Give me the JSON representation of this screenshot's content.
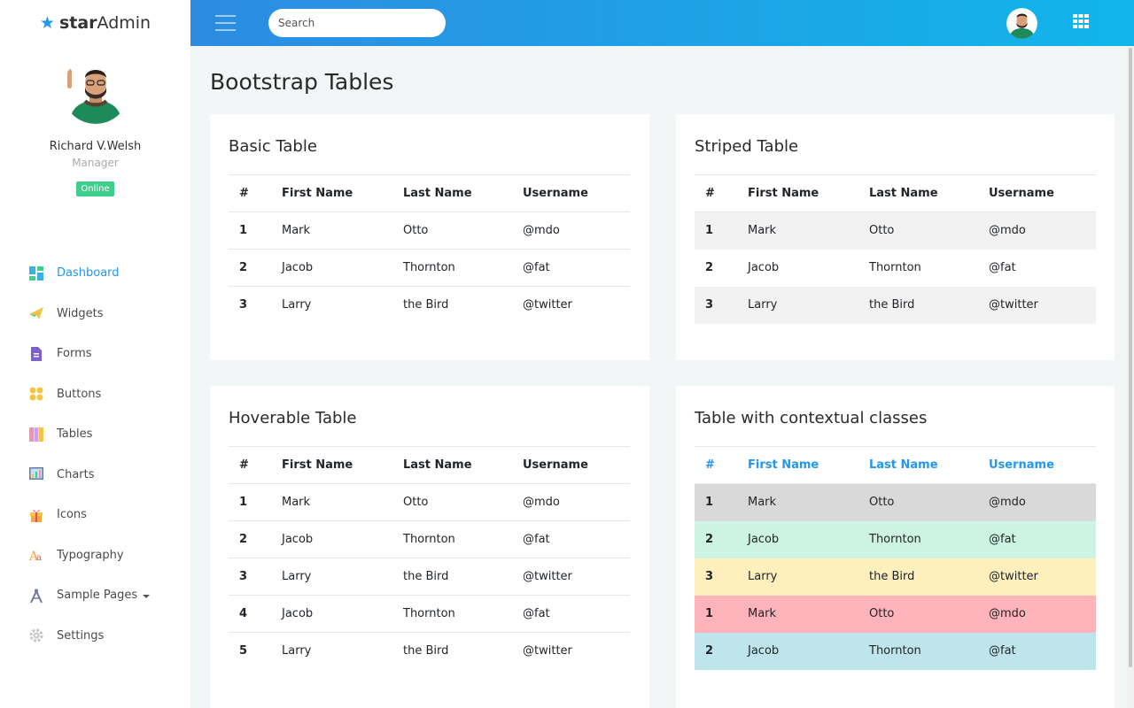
{
  "brand": {
    "prefix": "star",
    "suffix": "Admin"
  },
  "profile": {
    "name": "Richard V.Welsh",
    "role": "Manager",
    "status": "Online"
  },
  "sidebar": {
    "items": [
      {
        "label": "Dashboard",
        "icon": "dashboard-icon"
      },
      {
        "label": "Widgets",
        "icon": "paper-plane-icon"
      },
      {
        "label": "Forms",
        "icon": "document-icon"
      },
      {
        "label": "Buttons",
        "icon": "circles-icon"
      },
      {
        "label": "Tables",
        "icon": "columns-icon"
      },
      {
        "label": "Charts",
        "icon": "chart-icon"
      },
      {
        "label": "Icons",
        "icon": "gift-icon"
      },
      {
        "label": "Typography",
        "icon": "font-icon"
      },
      {
        "label": "Sample Pages",
        "icon": "compass-icon"
      },
      {
        "label": "Settings",
        "icon": "gear-icon"
      }
    ]
  },
  "topbar": {
    "search_placeholder": "Search"
  },
  "page": {
    "title": "Bootstrap Tables"
  },
  "tables": {
    "headers": [
      "#",
      "First Name",
      "Last Name",
      "Username"
    ],
    "basic": {
      "title": "Basic Table",
      "rows": [
        [
          "1",
          "Mark",
          "Otto",
          "@mdo"
        ],
        [
          "2",
          "Jacob",
          "Thornton",
          "@fat"
        ],
        [
          "3",
          "Larry",
          "the Bird",
          "@twitter"
        ]
      ]
    },
    "striped": {
      "title": "Striped Table",
      "rows": [
        [
          "1",
          "Mark",
          "Otto",
          "@mdo"
        ],
        [
          "2",
          "Jacob",
          "Thornton",
          "@fat"
        ],
        [
          "3",
          "Larry",
          "the Bird",
          "@twitter"
        ]
      ]
    },
    "hoverable": {
      "title": "Hoverable Table",
      "rows": [
        [
          "1",
          "Mark",
          "Otto",
          "@mdo"
        ],
        [
          "2",
          "Jacob",
          "Thornton",
          "@fat"
        ],
        [
          "3",
          "Larry",
          "the Bird",
          "@twitter"
        ],
        [
          "4",
          "Jacob",
          "Thornton",
          "@fat"
        ],
        [
          "5",
          "Larry",
          "the Bird",
          "@twitter"
        ]
      ]
    },
    "contextual": {
      "title": "Table with contextual classes",
      "rows": [
        [
          "1",
          "Mark",
          "Otto",
          "@mdo"
        ],
        [
          "2",
          "Jacob",
          "Thornton",
          "@fat"
        ],
        [
          "3",
          "Larry",
          "the Bird",
          "@twitter"
        ],
        [
          "1",
          "Mark",
          "Otto",
          "@mdo"
        ],
        [
          "2",
          "Jacob",
          "Thornton",
          "@fat"
        ]
      ]
    }
  },
  "colors": {
    "accent": "#2196f3",
    "online": "#3ecf8e",
    "row_grey": "#d9d9d9",
    "row_green": "#cdf3e3",
    "row_yellow": "#ffefbd",
    "row_red": "#ffb3bb",
    "row_blue": "#bee5eb"
  }
}
